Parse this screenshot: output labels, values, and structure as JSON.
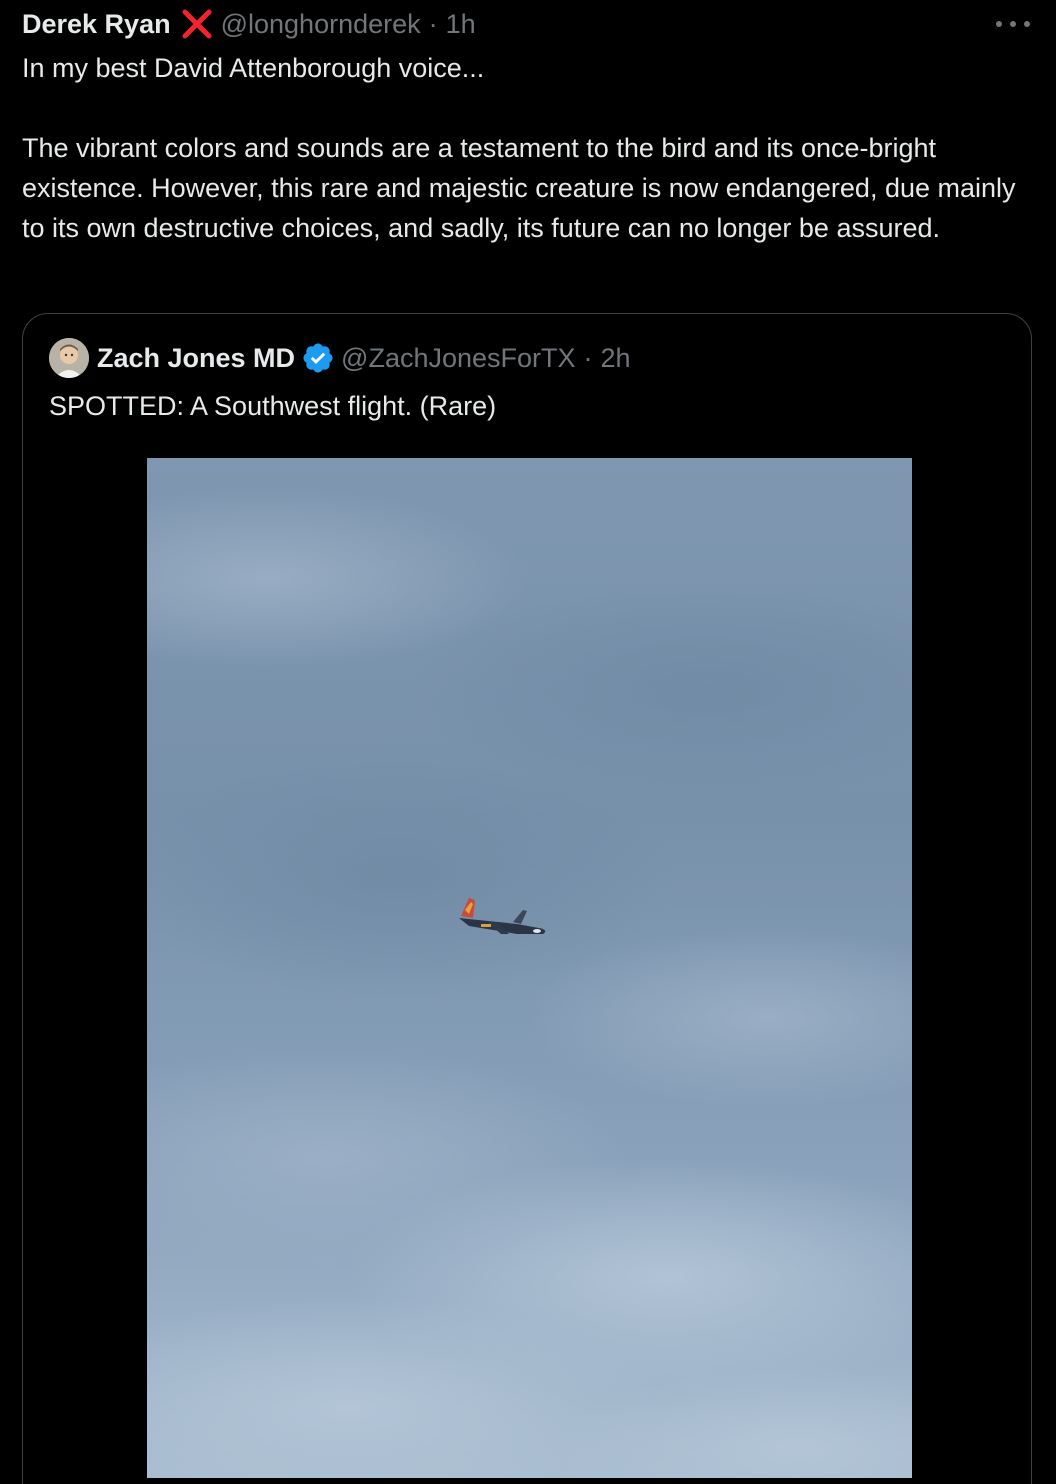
{
  "tweet": {
    "author_name": "Derek Ryan",
    "author_badge_icon": "red-x-icon",
    "author_handle": "@longhornderek",
    "separator": "·",
    "time": "1h",
    "more_icon": "more-horizontal-icon",
    "text_line_1": "In my best David Attenborough voice...",
    "text_paragraph_2": "The vibrant colors and sounds are a testament to the bird and its once-bright existence. However, this rare and majestic creature is now endangered, due mainly to its own destructive choices, and sadly, its future can no longer be assured."
  },
  "quoted_tweet": {
    "author_name": "Zach Jones MD",
    "verified_icon": "verified-badge-icon",
    "author_handle": "@ZachJonesForTX",
    "separator": "·",
    "time": "2h",
    "text": "SPOTTED: A Southwest flight. (Rare)",
    "media_description_icon": "airplane-in-sky-photo"
  },
  "colors": {
    "background": "#000000",
    "text_primary": "#e7e9ea",
    "text_secondary": "#71767b",
    "verified_blue": "#1d9bf0",
    "red_x": "#f4212e",
    "border": "#3e4144"
  }
}
